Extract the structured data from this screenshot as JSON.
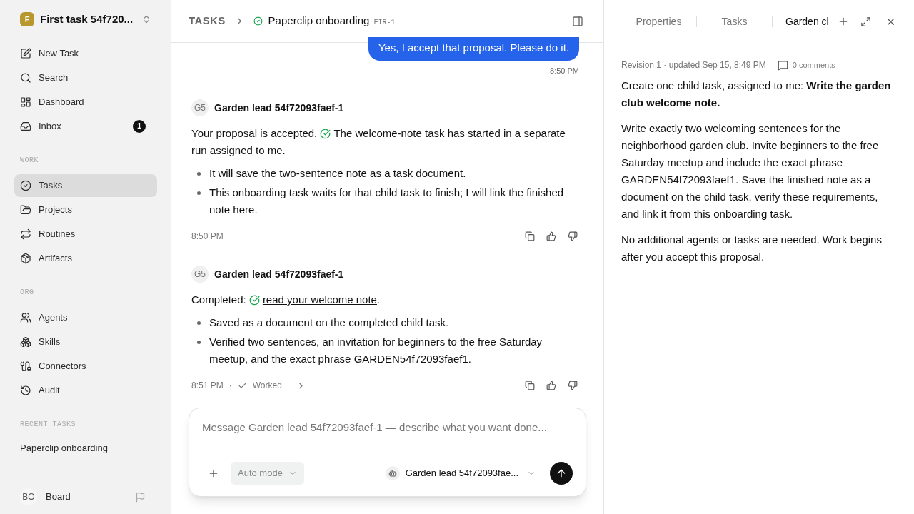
{
  "workspace": {
    "initial": "F",
    "name": "First task 54f720..."
  },
  "nav": [
    {
      "label": "New Task",
      "selected": false
    },
    {
      "label": "Search",
      "selected": false
    },
    {
      "label": "Dashboard",
      "selected": false
    },
    {
      "label": "Inbox",
      "badge": "1",
      "selected": false
    }
  ],
  "sections": [
    {
      "title": "WORK",
      "items": [
        {
          "label": "Tasks",
          "selected": true
        },
        {
          "label": "Projects",
          "selected": false
        },
        {
          "label": "Routines",
          "selected": false
        },
        {
          "label": "Artifacts",
          "selected": false
        }
      ]
    },
    {
      "title": "ORG",
      "items": [
        {
          "label": "Agents",
          "selected": false
        },
        {
          "label": "Skills",
          "selected": false
        },
        {
          "label": "Connectors",
          "selected": false
        },
        {
          "label": "Audit",
          "selected": false
        }
      ]
    }
  ],
  "recent": {
    "title": "RECENT TASKS",
    "items": [
      "Paperclip onboarding"
    ]
  },
  "user": {
    "initials": "BO",
    "name": "Board"
  },
  "breadcrumb": {
    "root": "TASKS",
    "title": "Paperclip onboarding",
    "id": "FIR-1"
  },
  "messages": [
    {
      "kind": "user",
      "text": "Yes, I accept that proposal. Please do it.",
      "time": "8:50 PM"
    },
    {
      "kind": "agent",
      "avatar": "G5",
      "author": "Garden lead 54f72093faef-1",
      "before": "Your proposal is accepted. ",
      "link": "The welcome-note task",
      "after": " has started in a separate run assigned to me.",
      "bullets": [
        "It will save the two-sentence note as a task document.",
        "This onboarding task waits for that child task to finish; I will link the finished note here."
      ],
      "time": "8:50 PM"
    },
    {
      "kind": "agent",
      "avatar": "G5",
      "author": "Garden lead 54f72093faef-1",
      "before": "Completed: ",
      "link": "read your welcome note",
      "after": ".",
      "bullets": [
        "Saved as a document on the completed child task.",
        "Verified two sentences, an invitation for beginners to the free Saturday meetup, and the exact phrase GARDEN54f72093faef1."
      ],
      "time": "8:51 PM",
      "separator": "·",
      "status": "Worked"
    }
  ],
  "composer": {
    "placeholder": "Message Garden lead 54f72093faef-1 — describe what you want done...",
    "mode": "Auto mode",
    "agent": "Garden lead 54f72093fae..."
  },
  "panel": {
    "tabs": [
      {
        "label": "Properties",
        "selected": false
      },
      {
        "label": "Tasks",
        "selected": false
      },
      {
        "label": "Garden cl",
        "selected": true
      }
    ],
    "meta": "Revision 1 · updated Sep 15, 8:49 PM",
    "comments": "0 comments",
    "paragraphs": [
      "Create one child task, assigned to me: **Write the garden club welcome note.**",
      "Write exactly two welcoming sentences for the neighborhood garden club. Invite beginners to the free Saturday meetup and include the exact phrase GARDEN54f72093faef1. Save the finished note as a document on the child task, verify these requirements, and link it from this onboarding task.",
      "No additional agents or tasks are needed. Work begins after you accept this proposal."
    ]
  }
}
